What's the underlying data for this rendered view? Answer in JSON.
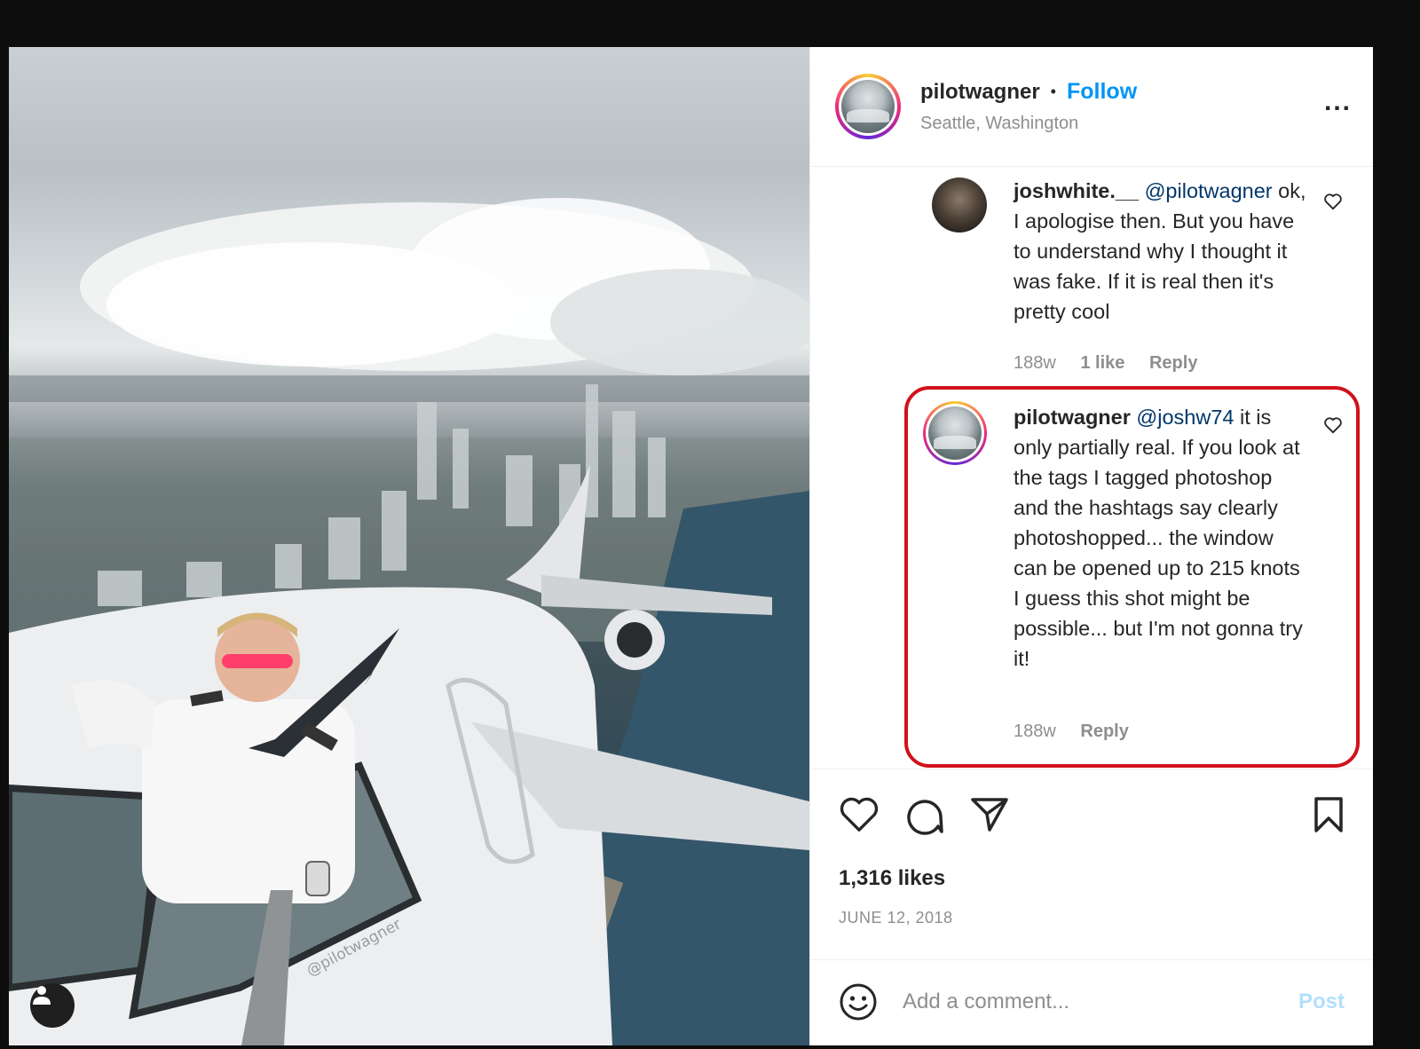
{
  "header": {
    "username": "pilotwagner",
    "separator": "•",
    "follow_label": "Follow",
    "location": "Seattle, Washington",
    "more_label": "..."
  },
  "photo": {
    "watermark": "@pilotwagner",
    "user_tag_icon": "person-icon"
  },
  "comments": [
    {
      "username": "joshwhite.__",
      "mention": "@pilotwagner",
      "text": " ok, I apologise then. But you have to understand why I thought it was fake. If it is real then it's pretty cool",
      "age": "188w",
      "likes": "1 like",
      "reply_label": "Reply"
    },
    {
      "username": "pilotwagner",
      "mention": "@joshw74",
      "text": " it is only partially real. If you look at the tags I tagged photoshop and the hashtags say clearly photoshopped... the window can be opened up to 215 knots I guess this shot might be possible... but I'm not gonna try it!",
      "age": "188w",
      "reply_label": "Reply"
    }
  ],
  "actions": {
    "likes": "1,316 likes",
    "date": "JUNE 12, 2018"
  },
  "add_comment": {
    "placeholder": "Add a comment...",
    "post_label": "Post"
  },
  "colors": {
    "follow": "#0095f6",
    "post_disabled": "#b2dffc",
    "highlight_border": "#d0121b",
    "meta_text": "#8e8e8e"
  }
}
